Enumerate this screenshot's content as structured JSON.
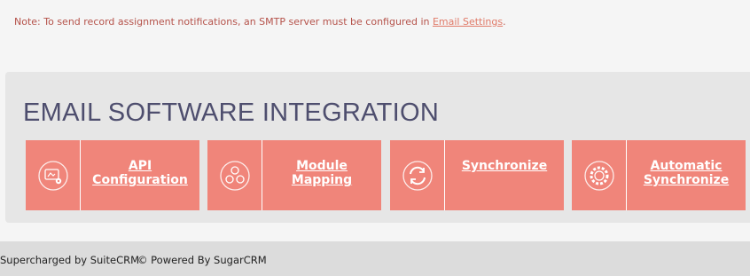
{
  "note": {
    "text": "Note: To send record assignment notifications, an SMTP server must be configured in ",
    "link": "Email Settings",
    "suffix": "."
  },
  "panel": {
    "title": "EMAIL SOFTWARE INTEGRATION",
    "tiles": [
      {
        "line1": "API",
        "line2": "Configuration",
        "icon": "api-config-icon"
      },
      {
        "line1": "Module",
        "line2": "Mapping",
        "icon": "module-mapping-icon"
      },
      {
        "line1": "Synchronize",
        "line2": "",
        "icon": "sync-icon"
      },
      {
        "line1": "Automatic",
        "line2": "Synchronize",
        "icon": "auto-sync-icon"
      }
    ],
    "tile_color": "#f0857a"
  },
  "footer": {
    "left": "Supercharged by SuiteCRM",
    "right": "© Powered By SugarCRM"
  }
}
